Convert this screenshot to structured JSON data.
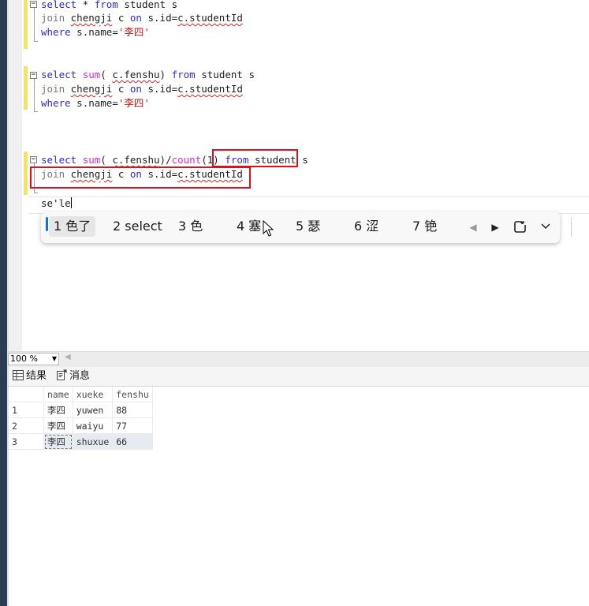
{
  "editor": {
    "lines": [
      {
        "tokens": [
          {
            "t": "select",
            "c": "kw"
          },
          {
            "t": " * "
          },
          {
            "t": "from",
            "c": "kw"
          },
          {
            "t": " student s"
          }
        ]
      },
      {
        "tokens": [
          {
            "t": "join",
            "c": "gray"
          },
          {
            "t": " "
          },
          {
            "t": "chengji",
            "c": "sq"
          },
          {
            "t": " c "
          },
          {
            "t": "on",
            "c": "kw"
          },
          {
            "t": " s.id="
          },
          {
            "t": "c.studentId",
            "c": "sq"
          }
        ]
      },
      {
        "tokens": [
          {
            "t": "where",
            "c": "kw"
          },
          {
            "t": " s.name="
          },
          {
            "t": "'李四'",
            "c": "str"
          }
        ]
      },
      {
        "tokens": [
          {
            "t": "select",
            "c": "kw"
          },
          {
            "t": " "
          },
          {
            "t": "sum",
            "c": "fn"
          },
          {
            "t": "( "
          },
          {
            "t": "c.fenshu",
            "c": "sq"
          },
          {
            "t": ") "
          },
          {
            "t": "from",
            "c": "kw"
          },
          {
            "t": " student s"
          }
        ]
      },
      {
        "tokens": [
          {
            "t": "join",
            "c": "gray"
          },
          {
            "t": " "
          },
          {
            "t": "chengji",
            "c": "sq"
          },
          {
            "t": " c "
          },
          {
            "t": "on",
            "c": "kw"
          },
          {
            "t": " s.id="
          },
          {
            "t": "c.studentId",
            "c": "sq"
          }
        ]
      },
      {
        "tokens": [
          {
            "t": "where",
            "c": "kw"
          },
          {
            "t": " s.name="
          },
          {
            "t": "'李四'",
            "c": "str"
          }
        ]
      },
      {
        "tokens": [
          {
            "t": "select",
            "c": "kw"
          },
          {
            "t": " "
          },
          {
            "t": "sum",
            "c": "fn"
          },
          {
            "t": "( "
          },
          {
            "t": "c.fenshu",
            "c": "sq"
          },
          {
            "t": ")/"
          },
          {
            "t": "count",
            "c": "fn"
          },
          {
            "t": "(1) "
          },
          {
            "t": "from",
            "c": "kw"
          },
          {
            "t": " student s"
          }
        ]
      },
      {
        "tokens": [
          {
            "t": "join",
            "c": "gray"
          },
          {
            "t": " "
          },
          {
            "t": "chengji",
            "c": "sq"
          },
          {
            "t": " c "
          },
          {
            "t": "on",
            "c": "kw"
          },
          {
            "t": " s.id="
          },
          {
            "t": "c.studentId",
            "c": "sq"
          }
        ]
      },
      {
        "tokens": [
          {
            "t": "se'le"
          }
        ]
      }
    ]
  },
  "ime": {
    "candidates": [
      "1 色了",
      "2 select",
      "3 色",
      "4 塞",
      "5 瑟",
      "6 涩",
      "7 铯"
    ],
    "prev_icon": "triangle-left-icon",
    "next_icon": "triangle-right-icon",
    "emoji_icon": "emoji-panel-icon",
    "expand_icon": "chevron-down-icon"
  },
  "status": {
    "zoom": "100 %"
  },
  "results": {
    "tabs": [
      {
        "label": "结果",
        "icon": "grid-icon"
      },
      {
        "label": "消息",
        "icon": "message-icon"
      }
    ],
    "columns": [
      "name",
      "xueke",
      "fenshu"
    ],
    "rows": [
      {
        "n": "1",
        "cells": [
          "李四",
          "yuwen",
          "88"
        ]
      },
      {
        "n": "2",
        "cells": [
          "李四",
          "waiyu",
          "77"
        ]
      },
      {
        "n": "3",
        "cells": [
          "李四",
          "shuxue",
          "66"
        ]
      }
    ]
  },
  "colors": {
    "keyword": "#2b2bd6",
    "function": "#d12bd1",
    "string": "#c91818",
    "annotation_box": "#d9121b",
    "change_mark": "#f2e36a"
  }
}
